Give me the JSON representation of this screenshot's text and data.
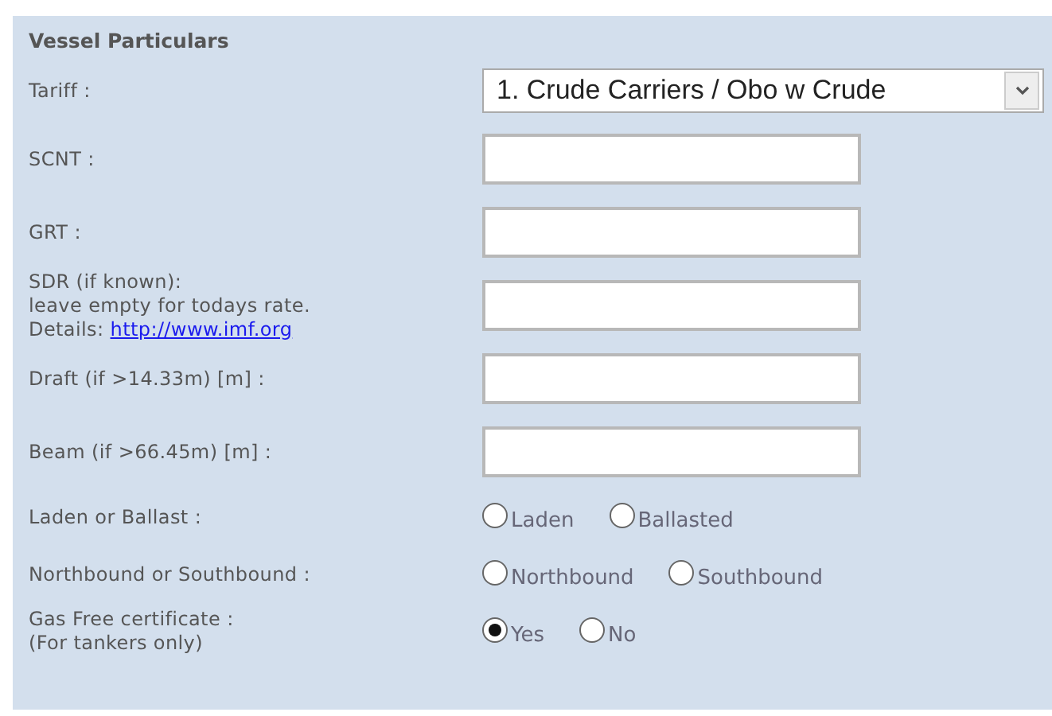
{
  "section": {
    "title": "Vessel Particulars"
  },
  "fields": [
    {
      "kind": "select",
      "label": [
        "Tariff :"
      ],
      "value": "1. Crude Carriers / Obo w Crude"
    },
    {
      "kind": "text",
      "label": [
        "SCNT :"
      ]
    },
    {
      "kind": "text",
      "label": [
        "GRT :"
      ]
    },
    {
      "kind": "text",
      "label": [
        "SDR (if known):",
        "leave empty for todays rate."
      ],
      "link": {
        "prefix": "Details:",
        "text": "http://www.imf.org"
      }
    },
    {
      "kind": "text",
      "label": [
        "Draft (if >14.33m) [m] :"
      ]
    },
    {
      "kind": "text",
      "label": [
        "Beam (if >66.45m) [m] :"
      ]
    },
    {
      "kind": "radio",
      "label": [
        "Laden or Ballast :"
      ],
      "options": [
        {
          "label": "Laden",
          "selected": false
        },
        {
          "label": "Ballasted",
          "selected": false
        }
      ]
    },
    {
      "kind": "radio",
      "label": [
        "Northbound or Southbound :"
      ],
      "options": [
        {
          "label": "Northbound",
          "selected": false
        },
        {
          "label": "Southbound",
          "selected": false
        }
      ]
    },
    {
      "kind": "radio",
      "label": [
        "Gas Free certificate :",
        "(For tankers only)"
      ],
      "options": [
        {
          "label": "Yes",
          "selected": true
        },
        {
          "label": "No",
          "selected": false
        }
      ]
    }
  ]
}
